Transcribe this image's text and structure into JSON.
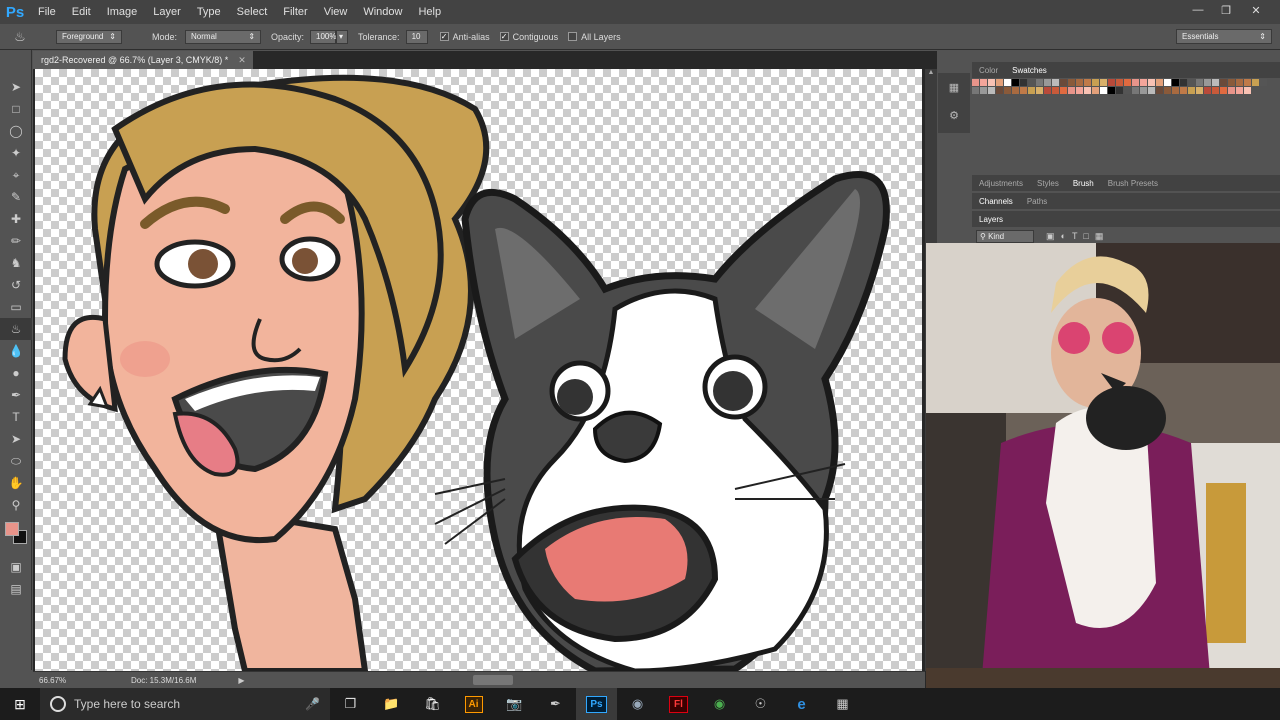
{
  "app": {
    "logo": "Ps"
  },
  "menu": [
    "File",
    "Edit",
    "Image",
    "Layer",
    "Type",
    "Select",
    "Filter",
    "View",
    "Window",
    "Help"
  ],
  "options": {
    "fill_source": "Foreground",
    "mode_label": "Mode:",
    "mode_value": "Normal",
    "opacity_label": "Opacity:",
    "opacity_value": "100%",
    "tolerance_label": "Tolerance:",
    "tolerance_value": "10",
    "antialias_label": "Anti-alias",
    "contiguous_label": "Contiguous",
    "all_layers_label": "All Layers",
    "workspace": "Essentials"
  },
  "document": {
    "tab_title": "rgd2-Recovered @ 66.7% (Layer 3, CMYK/8) *",
    "zoom": "66.67%",
    "doc_size": "Doc: 15.3M/16.6M"
  },
  "panels": {
    "color_tabs": [
      "Color",
      "Swatches"
    ],
    "adjust_tabs": [
      "Adjustments",
      "Styles",
      "Brush",
      "Brush Presets"
    ],
    "channel_tabs": [
      "Channels",
      "Paths"
    ],
    "layers_tab": "Layers",
    "layers_filter": "Kind"
  },
  "taskbar": {
    "search_placeholder": "Type here to search"
  },
  "colors": {
    "foreground": "#e8948a",
    "background": "#111111"
  }
}
